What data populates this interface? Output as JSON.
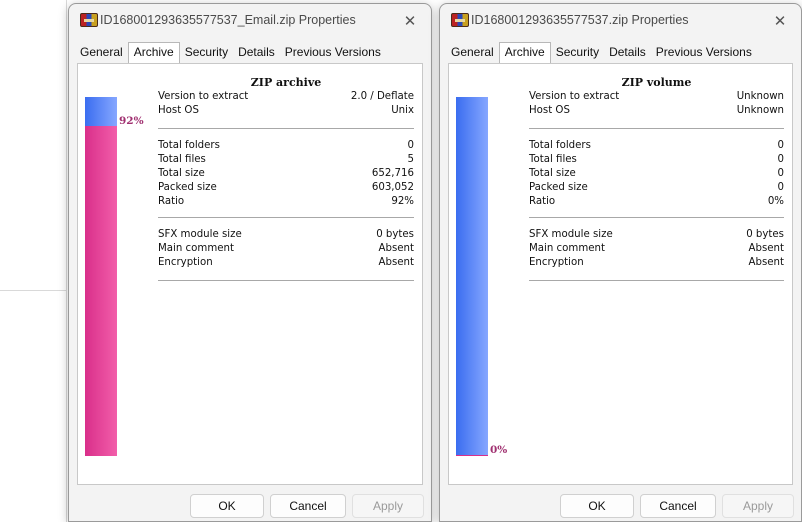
{
  "dialogs": [
    {
      "title": "ID168001293635577537_Email.zip Properties",
      "close": "✕",
      "tabs": [
        "General",
        "Archive",
        "Security",
        "Details",
        "Previous Versions"
      ],
      "active_tab": "Archive",
      "section_title": "ZIP archive",
      "group1": [
        {
          "label": "Version to extract",
          "value": "2.0 / Deflate"
        },
        {
          "label": "Host OS",
          "value": "Unix"
        }
      ],
      "group2": [
        {
          "label": "Total folders",
          "value": "0"
        },
        {
          "label": "Total files",
          "value": "5"
        },
        {
          "label": "Total size",
          "value": "652,716"
        },
        {
          "label": "Packed size",
          "value": "603,052"
        },
        {
          "label": "Ratio",
          "value": "92%"
        }
      ],
      "group3": [
        {
          "label": "SFX module size",
          "value": "0 bytes"
        },
        {
          "label": "Main comment",
          "value": "Absent"
        },
        {
          "label": "Encryption",
          "value": "Absent"
        }
      ],
      "ratio_label": "92%",
      "ratio_fraction": 0.92,
      "buttons": {
        "ok": "OK",
        "cancel": "Cancel",
        "apply": "Apply"
      }
    },
    {
      "title": "ID168001293635577537.zip Properties",
      "close": "✕",
      "tabs": [
        "General",
        "Archive",
        "Security",
        "Details",
        "Previous Versions"
      ],
      "active_tab": "Archive",
      "section_title": "ZIP volume",
      "group1": [
        {
          "label": "Version to extract",
          "value": "Unknown"
        },
        {
          "label": "Host OS",
          "value": "Unknown"
        }
      ],
      "group2": [
        {
          "label": "Total folders",
          "value": "0"
        },
        {
          "label": "Total files",
          "value": "0"
        },
        {
          "label": "Total size",
          "value": "0"
        },
        {
          "label": "Packed size",
          "value": "0"
        },
        {
          "label": "Ratio",
          "value": "0%"
        }
      ],
      "group3": [
        {
          "label": "SFX module size",
          "value": "0 bytes"
        },
        {
          "label": "Main comment",
          "value": "Absent"
        },
        {
          "label": "Encryption",
          "value": "Absent"
        }
      ],
      "ratio_label": "0%",
      "ratio_fraction": 0.0,
      "buttons": {
        "ok": "OK",
        "cancel": "Cancel",
        "apply": "Apply"
      }
    }
  ],
  "colors": {
    "packed_bar": "#e23d95",
    "unpacked_bar": "#5b82fb",
    "ratio_text": "#a03070"
  }
}
